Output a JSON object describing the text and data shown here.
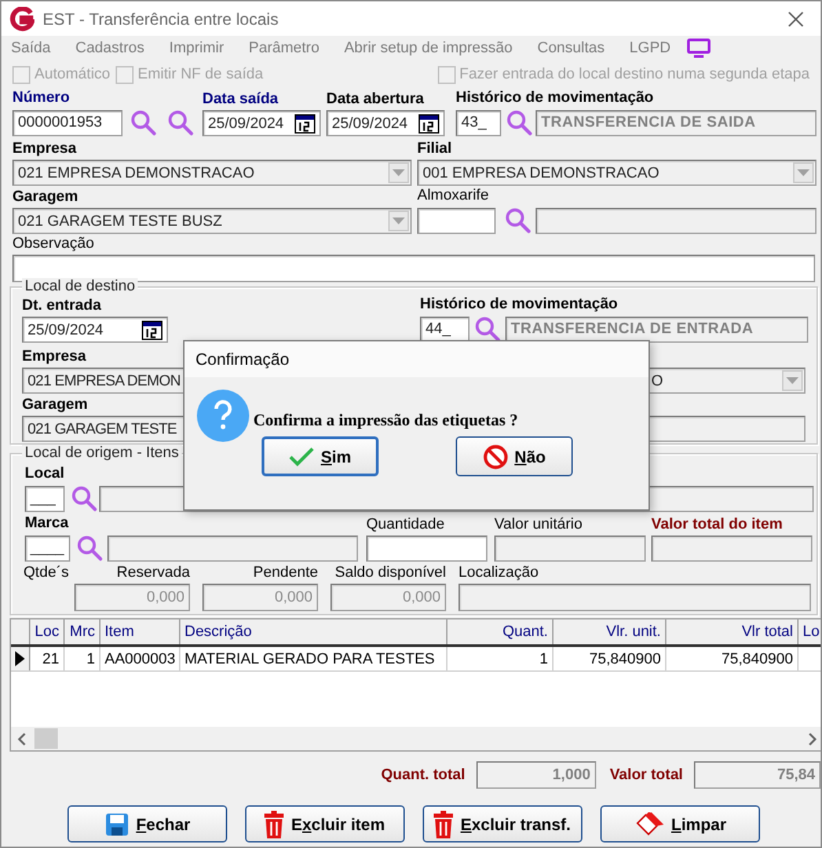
{
  "window": {
    "title": "EST - Transferência entre locais"
  },
  "menu": [
    {
      "label": "Saída"
    },
    {
      "label": "Cadastros"
    },
    {
      "label": "Imprimir"
    },
    {
      "label": "Parâmetro"
    },
    {
      "label": "Abrir setup de impressão"
    },
    {
      "label": "Consultas"
    },
    {
      "label": "LGPD"
    }
  ],
  "options": [
    {
      "label": "Automático",
      "checked": false
    },
    {
      "label": "Emitir NF de saída",
      "checked": false
    },
    {
      "label": "Fazer entrada do local destino numa segunda etapa",
      "checked": false
    }
  ],
  "saida": {
    "numero": {
      "label": "Número",
      "kind": "required",
      "value": "0000001953"
    },
    "data_saida": {
      "label": "Data saída",
      "kind": "required",
      "value": "25/09/2024"
    },
    "data_abertura": {
      "label": "Data abertura",
      "kind": "bold",
      "value": "25/09/2024"
    },
    "historico": {
      "label": "Histórico de movimentação",
      "kind": "bold",
      "code": "43_",
      "description": "TRANSFERENCIA DE SAIDA"
    },
    "empresa": {
      "label": "Empresa",
      "kind": "bold",
      "value": "021 EMPRESA DEMONSTRACAO"
    },
    "filial": {
      "label": "Filial",
      "kind": "bold",
      "value": "001 EMPRESA DEMONSTRACAO"
    },
    "garagem": {
      "label": "Garagem",
      "kind": "bold",
      "value": "021 GARAGEM TESTE BUSZ"
    },
    "almoxarife": {
      "label": "Almoxarife",
      "kind": "plain"
    },
    "observacao": {
      "label": "Observação",
      "kind": "plain"
    }
  },
  "destino": {
    "title": "Local de destino",
    "dt_entrada": {
      "label": "Dt. entrada",
      "kind": "bold",
      "value": "25/09/2024"
    },
    "historico": {
      "label": "Histórico de movimentação",
      "kind": "bold",
      "code": "44_",
      "description": "TRANSFERENCIA DE ENTRADA"
    },
    "empresa": {
      "label": "Empresa",
      "kind": "bold",
      "value": "021 EMPRESA DEMON"
    },
    "filial": {
      "value": "O"
    },
    "garagem": {
      "label": "Garagem",
      "kind": "bold",
      "value": "021 GARAGEM TESTE"
    }
  },
  "origem": {
    "title": "Local de origem - Itens",
    "local": {
      "label": "Local",
      "kind": "bold",
      "value": "___"
    },
    "marca": {
      "label": "Marca",
      "kind": "bold",
      "value": "____"
    },
    "quantidade": {
      "label": "Quantidade",
      "kind": "plain"
    },
    "valor_unitario": {
      "label": "Valor unitário",
      "kind": "plain"
    },
    "valor_total": {
      "label": "Valor total do item",
      "kind": "total"
    },
    "qtdes_label": "Qtde´s",
    "qtdes": [
      {
        "label": "Reservada",
        "value": "0,000"
      },
      {
        "label": "Pendente",
        "value": "0,000"
      },
      {
        "label": "Saldo disponível",
        "value": "0,000"
      }
    ],
    "localizacao": {
      "label": "Localização",
      "kind": "plain"
    }
  },
  "table": {
    "columns": [
      "Loc",
      "Mrc",
      "Item",
      "Descrição",
      "Quant.",
      "Vlr. unit.",
      "Vlr total",
      "Lo"
    ],
    "rows": [
      {
        "selected": true,
        "cells": [
          "21",
          "1",
          "AA000003",
          "MATERIAL GERADO PARA TESTES",
          "1",
          "75,840900",
          "75,840900"
        ]
      }
    ]
  },
  "totals": [
    {
      "label": "Quant. total",
      "value": "1,000"
    },
    {
      "label": "Valor total",
      "value": "75,84"
    }
  ],
  "buttons": [
    {
      "key": "F",
      "post": "echar",
      "kind": "save"
    },
    {
      "pre": "E",
      "key": "x",
      "post": "cluir item",
      "kind": "delete"
    },
    {
      "key": "E",
      "post": "xcluir transf.",
      "kind": "delete"
    },
    {
      "key": "L",
      "post": "impar",
      "kind": "clear"
    }
  ],
  "dialog": {
    "title": "Confirmação",
    "message": "Confirma a impressão das etiquetas ?",
    "buttons": [
      {
        "key": "S",
        "post": "im",
        "kind": "confirm",
        "focused": true
      },
      {
        "key": "N",
        "post": "ão",
        "kind": "cancel",
        "focused": false
      }
    ]
  }
}
